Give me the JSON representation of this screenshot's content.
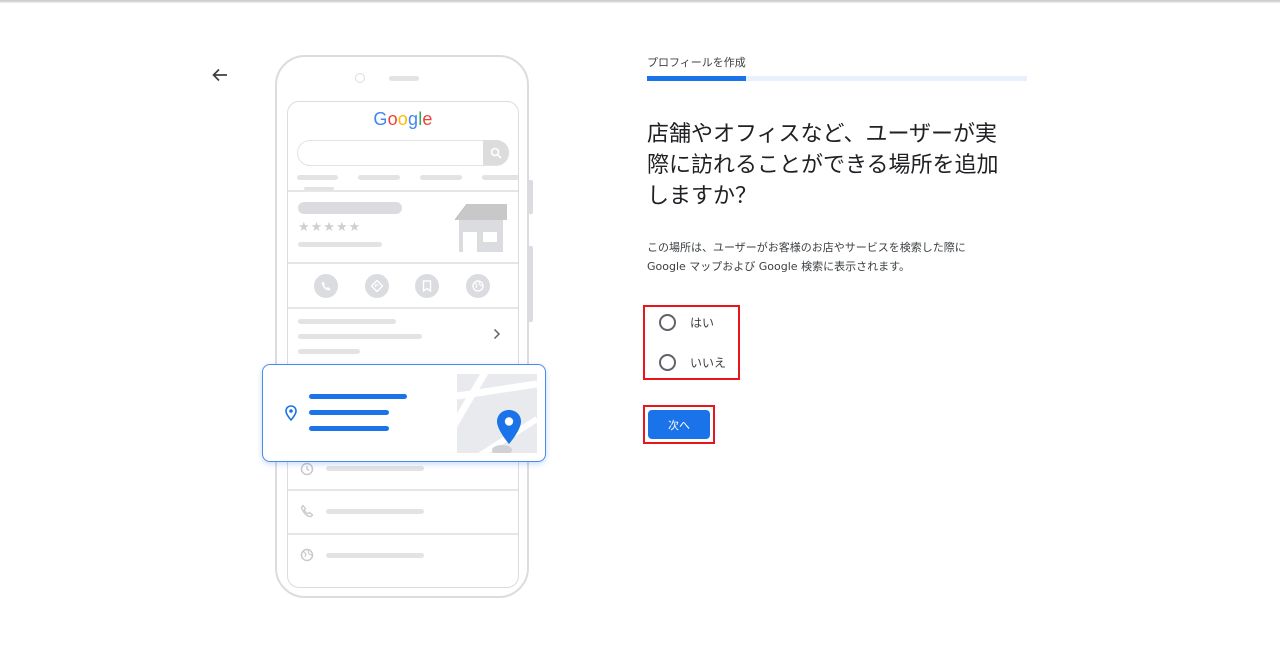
{
  "nav": {
    "back_icon": "arrow-left-icon"
  },
  "illustration": {
    "logo": [
      {
        "ch": "G",
        "color": "#4285F4"
      },
      {
        "ch": "o",
        "color": "#EA4335"
      },
      {
        "ch": "o",
        "color": "#FBBC05"
      },
      {
        "ch": "g",
        "color": "#4285F4"
      },
      {
        "ch": "l",
        "color": "#34A853"
      },
      {
        "ch": "e",
        "color": "#EA4335"
      }
    ],
    "stars": "★★★★★",
    "action_icons": [
      "phone-icon",
      "directions-icon",
      "bookmark-icon",
      "website-icon"
    ],
    "list_icons": [
      "clock-icon",
      "phone-icon",
      "globe-icon"
    ],
    "card_pin_icon": "location-pin-icon",
    "accent": "#1a73e8"
  },
  "step": {
    "label": "プロフィールを作成",
    "progress_fraction": 0.26
  },
  "question": {
    "lines": [
      "店舗やオフィスなど、ユーザーが実",
      "際に訪れることができる場所を追加",
      "しますか？"
    ]
  },
  "description": {
    "lines": [
      "この場所は、ユーザーがお客様のお店やサービスを検索した際に",
      "Google マップおよび Google 検索に表示されます。"
    ]
  },
  "options": [
    {
      "label": "はい",
      "selected": false
    },
    {
      "label": "いいえ",
      "selected": false
    }
  ],
  "next_button": {
    "label": "次へ"
  },
  "highlight_color": "#e8161a"
}
